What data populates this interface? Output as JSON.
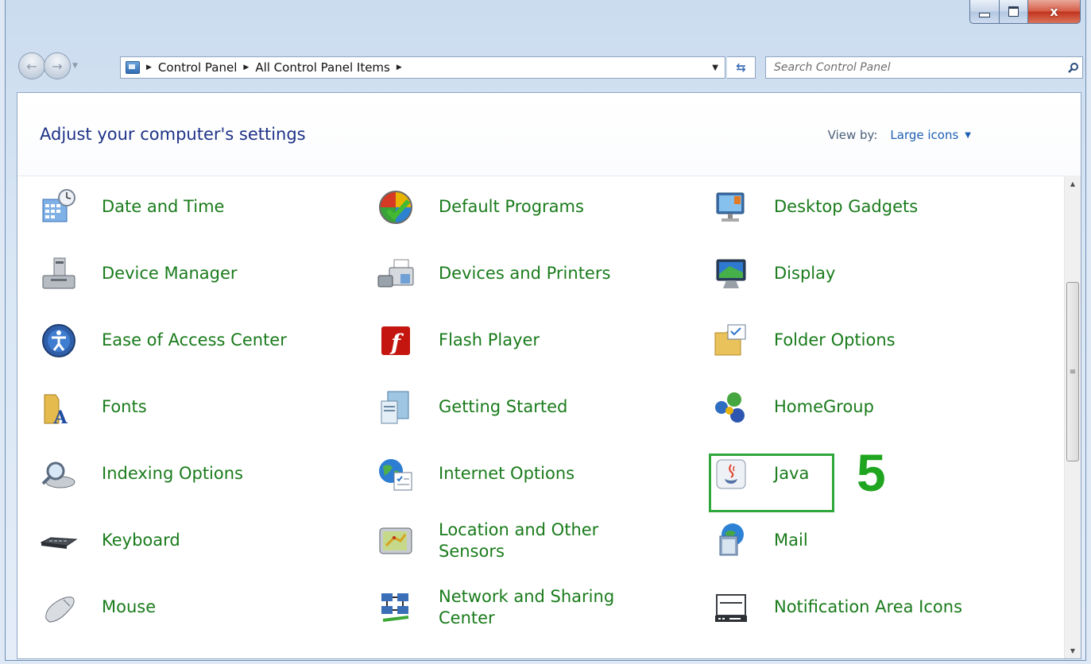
{
  "window": {
    "caption": {
      "minimize": "minimize",
      "maximize": "maximize",
      "close": "x"
    }
  },
  "nav": {
    "breadcrumb": [
      "Control Panel",
      "All Control Panel Items"
    ],
    "search_placeholder": "Search Control Panel"
  },
  "header": {
    "title": "Adjust your computer's settings",
    "view_by_label": "View by:",
    "view_by_value": "Large icons"
  },
  "items": [
    {
      "label": "Date and Time",
      "icon": "date-time-icon"
    },
    {
      "label": "Default Programs",
      "icon": "default-programs-icon"
    },
    {
      "label": "Desktop Gadgets",
      "icon": "desktop-gadgets-icon"
    },
    {
      "label": "Device Manager",
      "icon": "device-manager-icon"
    },
    {
      "label": "Devices and Printers",
      "icon": "printer-icon"
    },
    {
      "label": "Display",
      "icon": "display-icon"
    },
    {
      "label": "Ease of Access Center",
      "icon": "ease-of-access-icon"
    },
    {
      "label": "Flash Player",
      "icon": "flash-player-icon"
    },
    {
      "label": "Folder Options",
      "icon": "folder-options-icon"
    },
    {
      "label": "Fonts",
      "icon": "fonts-icon"
    },
    {
      "label": "Getting Started",
      "icon": "getting-started-icon"
    },
    {
      "label": "HomeGroup",
      "icon": "homegroup-icon"
    },
    {
      "label": "Indexing Options",
      "icon": "indexing-icon"
    },
    {
      "label": "Internet Options",
      "icon": "internet-options-icon"
    },
    {
      "label": "Java",
      "icon": "java-icon"
    },
    {
      "label": "Keyboard",
      "icon": "keyboard-icon"
    },
    {
      "label": "Location and Other Sensors",
      "icon": "location-sensors-icon"
    },
    {
      "label": "Mail",
      "icon": "mail-icon"
    },
    {
      "label": "Mouse",
      "icon": "mouse-icon"
    },
    {
      "label": "Network and Sharing Center",
      "icon": "network-icon"
    },
    {
      "label": "Notification Area Icons",
      "icon": "notification-area-icon"
    }
  ],
  "annotation": {
    "step_number": "5",
    "color": "#2ea83a"
  },
  "colors": {
    "link_green": "#197b1b",
    "title_blue": "#1e3287",
    "link_blue": "#1e5fb4"
  }
}
